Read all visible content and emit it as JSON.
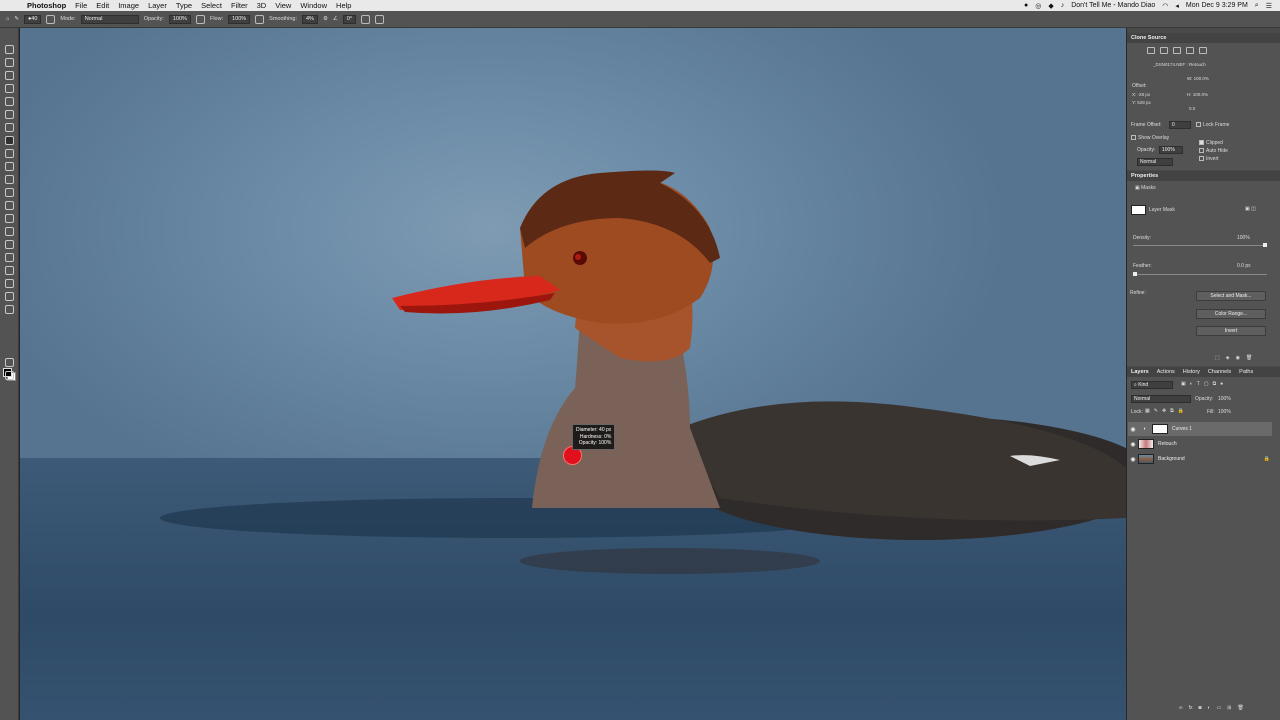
{
  "menubar": {
    "app": "Photoshop",
    "items": [
      "File",
      "Edit",
      "Image",
      "Layer",
      "Type",
      "Select",
      "Filter",
      "3D",
      "View",
      "Window",
      "Help"
    ],
    "now_playing": "Don't Tell Me - Mando Diao",
    "clock": "Mon Dec 9  3:29 PM"
  },
  "options": {
    "mode_label": "Mode:",
    "mode_value": "Normal",
    "opacity_label": "Opacity:",
    "opacity_value": "100%",
    "flow_label": "Flow:",
    "flow_value": "100%",
    "smoothing_label": "Smoothing:",
    "smoothing_value": "4%",
    "angle_value": "0°"
  },
  "brush_tip": {
    "diameter": "Diameter: 40 px",
    "hardness": "Hardness:    0%",
    "opacity": "Opacity: 100%"
  },
  "clone_source": {
    "title": "Clone Source",
    "source_name": "_DSN0174.NEF : Retouch",
    "offset_label": "Offset:",
    "x": "X: -28 px",
    "y": "Y: 528 px",
    "w": "W: 100.0%",
    "h": "H: 100.0%",
    "angle": "0.0",
    "frame_offset_label": "Frame Offset:",
    "frame_offset_value": "0",
    "lock_frame": "Lock Frame",
    "show_overlay": "Show Overlay",
    "opacity_label": "Opacity:",
    "opacity_value": "100%",
    "blend": "Normal",
    "clipped": "Clipped",
    "auto_hide": "Auto Hide",
    "invert": "Invert"
  },
  "properties": {
    "title": "Properties",
    "masks_label": "Masks",
    "layer_mask_label": "Layer Mask",
    "density_label": "Density:",
    "density_value": "100%",
    "density_level": 1.0,
    "feather_label": "Feather:",
    "feather_value": "0.0 px",
    "feather_level": 0.0,
    "refine_label": "Refine:",
    "select_and_mask": "Select and Mask...",
    "color_range": "Color Range...",
    "invert": "Invert"
  },
  "layers_panel": {
    "tabs": [
      "Layers",
      "Actions",
      "History",
      "Channels",
      "Paths"
    ],
    "filter_kind": "Kind",
    "blend_mode": "Normal",
    "opacity_label": "Opacity:",
    "opacity_value": "100%",
    "lock_label": "Lock:",
    "fill_label": "Fill:",
    "fill_value": "100%",
    "layers": [
      {
        "name": "Curves 1"
      },
      {
        "name": "Retouch"
      },
      {
        "name": "Background"
      }
    ]
  },
  "colors": {
    "menubar_bg": "#e9e9e9",
    "panel_bg": "#535353",
    "selected_layer": "#6a6a6a",
    "brush_cursor": "#e0101c"
  }
}
